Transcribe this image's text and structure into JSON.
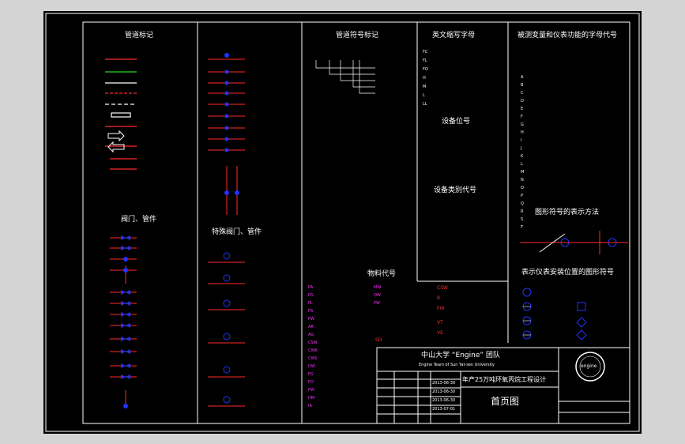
{
  "section_titles": {
    "pipeline_marks": "管道标记",
    "pipe_symbols": "管道符号标记",
    "abbreviations": "英文缩写字母",
    "measured_var_letters": "被测变量和仪表功能的字母代号",
    "valves": "阀门、管件",
    "special_valves": "特殊阀门、管件",
    "equipment_number": "设备位号",
    "equipment_class": "设备类别代号",
    "material": "物料代号",
    "instrument_symbol": "图形符号的表示方法",
    "instrument_position": "表示仪表安装位置的图形符号"
  },
  "abbreviations": [
    "FC",
    "FL",
    "FO",
    "H",
    "M",
    "L",
    "LL"
  ],
  "var_letters": [
    "A",
    "B",
    "C",
    "D",
    "E",
    "F",
    "G",
    "H",
    "I",
    "J",
    "K",
    "L",
    "M",
    "N",
    "O",
    "P",
    "Q",
    "R",
    "S",
    "T"
  ],
  "material_left": [
    "PA",
    "PG",
    "PL",
    "PS",
    "PW",
    "AR",
    "AG",
    "CSW",
    "CWR",
    "CWS",
    "DW",
    "FG",
    "FO",
    "FW",
    "HM",
    "IA",
    "MW",
    "OW",
    "PW"
  ],
  "material_right_red": [
    "CSW",
    "R",
    "FW",
    "VT",
    "VE",
    "SD"
  ],
  "title_block": {
    "company": "中山大学 “Engine” 团队",
    "company_en": "Engine Team of Sun Yat-sen University",
    "project": "年产25万吨环氧丙烷工程设计",
    "drawing_name": "首页图",
    "logo_text": "engine",
    "dates": [
      "2013-06-30",
      "2013-06-30",
      "2013-06-30",
      "2013-07-01"
    ]
  }
}
